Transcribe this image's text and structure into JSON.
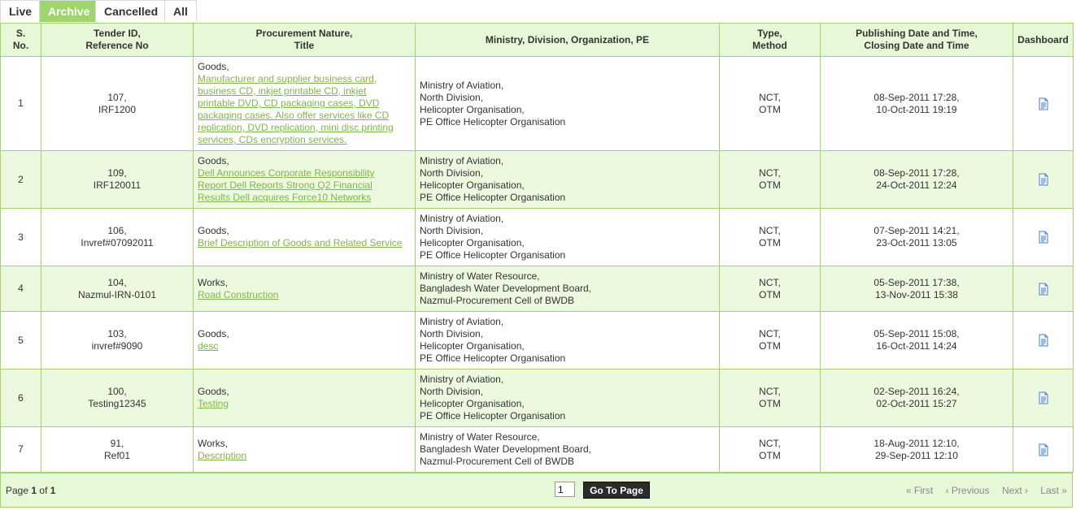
{
  "tabs": [
    {
      "label": "Live"
    },
    {
      "label": "Archive",
      "active": true
    },
    {
      "label": "Cancelled"
    },
    {
      "label": "All"
    }
  ],
  "headers": {
    "sno": [
      "S.",
      "No."
    ],
    "tender": [
      "Tender ID,",
      "Reference No"
    ],
    "procurement": [
      "Procurement Nature,",
      "Title"
    ],
    "ministry": [
      "Ministry, Division, Organization, PE"
    ],
    "type": [
      "Type,",
      "Method"
    ],
    "dates": [
      "Publishing Date and Time,",
      "Closing Date and Time"
    ],
    "dashboard": [
      "Dashboard"
    ]
  },
  "rows": [
    {
      "sno": "1",
      "tender": [
        "107,",
        "IRF1200"
      ],
      "nature": "Goods,",
      "title": [
        "Manufacturer and supplier business card,",
        "business CD, inkjet printable CD, inkjet",
        "printable DVD, CD packaging cases, DVD",
        "packaging cases. Also offer services like CD",
        "replication, DVD replication, mini disc printing",
        "services, CDs encryption services."
      ],
      "ministry": [
        "Ministry of Aviation,",
        "North Division,",
        "Helicopter Organisation,",
        "PE Office Helicopter Organisation"
      ],
      "type": [
        "NCT,",
        "OTM"
      ],
      "dates": [
        "08-Sep-2011 17:28,",
        "10-Oct-2011 19:19"
      ]
    },
    {
      "sno": "2",
      "tender": [
        "109,",
        "IRF120011"
      ],
      "nature": "Goods,",
      "title": [
        "Dell Announces Corporate Responsibility",
        "Report Dell Reports Strong Q2 Financial",
        "Results Dell acquires Force10 Networks"
      ],
      "ministry": [
        "Ministry of Aviation,",
        "North Division,",
        "Helicopter Organisation,",
        "PE Office Helicopter Organisation"
      ],
      "type": [
        "NCT,",
        "OTM"
      ],
      "dates": [
        "08-Sep-2011 17:28,",
        "24-Oct-2011 12:24"
      ]
    },
    {
      "sno": "3",
      "tender": [
        "106,",
        "Invref#07092011"
      ],
      "nature": "Goods,",
      "title": [
        "Brief Description of Goods and Related Service"
      ],
      "ministry": [
        "Ministry of Aviation,",
        "North Division,",
        "Helicopter Organisation,",
        "PE Office Helicopter Organisation"
      ],
      "type": [
        "NCT,",
        "OTM"
      ],
      "dates": [
        "07-Sep-2011 14:21,",
        "23-Oct-2011 13:05"
      ]
    },
    {
      "sno": "4",
      "tender": [
        "104,",
        "Nazmul-IRN-0101"
      ],
      "nature": "Works,",
      "title": [
        "Road Construction"
      ],
      "ministry": [
        "Ministry of Water Resource,",
        "Bangladesh Water Development Board,",
        "Nazmul-Procurement Cell of BWDB"
      ],
      "type": [
        "NCT,",
        "OTM"
      ],
      "dates": [
        "05-Sep-2011 17:38,",
        "13-Nov-2011 15:38"
      ]
    },
    {
      "sno": "5",
      "tender": [
        "103,",
        "invref#9090"
      ],
      "nature": "Goods,",
      "title": [
        "desc"
      ],
      "ministry": [
        "Ministry of Aviation,",
        "North Division,",
        "Helicopter Organisation,",
        "PE Office Helicopter Organisation"
      ],
      "type": [
        "NCT,",
        "OTM"
      ],
      "dates": [
        "05-Sep-2011 15:08,",
        "16-Oct-2011 14:24"
      ]
    },
    {
      "sno": "6",
      "tender": [
        "100,",
        "Testing12345"
      ],
      "nature": "Goods,",
      "title": [
        "Testing"
      ],
      "ministry": [
        "Ministry of Aviation,",
        "North Division,",
        "Helicopter Organisation,",
        "PE Office Helicopter Organisation"
      ],
      "type": [
        "NCT,",
        "OTM"
      ],
      "dates": [
        "02-Sep-2011 16:24,",
        "02-Oct-2011 15:27"
      ]
    },
    {
      "sno": "7",
      "tender": [
        "91,",
        "Ref01"
      ],
      "nature": "Works,",
      "title": [
        "Description"
      ],
      "ministry": [
        "Ministry of Water Resource,",
        "Bangladesh Water Development Board,",
        "Nazmul-Procurement Cell of BWDB"
      ],
      "type": [
        "NCT,",
        "OTM"
      ],
      "dates": [
        "18-Aug-2011 12:10,",
        "29-Sep-2011 12:10"
      ]
    }
  ],
  "footer": {
    "page_label": "Page",
    "current_page": "1",
    "of_label": "of",
    "total_pages": "1",
    "page_input_value": "1",
    "go_button": "Go To Page",
    "first": "« First",
    "previous": "‹ Previous",
    "next": "Next ›",
    "last": "Last »"
  },
  "icons": {
    "dashboard": "document-icon"
  },
  "colors": {
    "accent": "#9fd46e",
    "link": "#7fb64a",
    "header_bg": "#e6f8d7",
    "alt_row": "#ecf9df"
  }
}
